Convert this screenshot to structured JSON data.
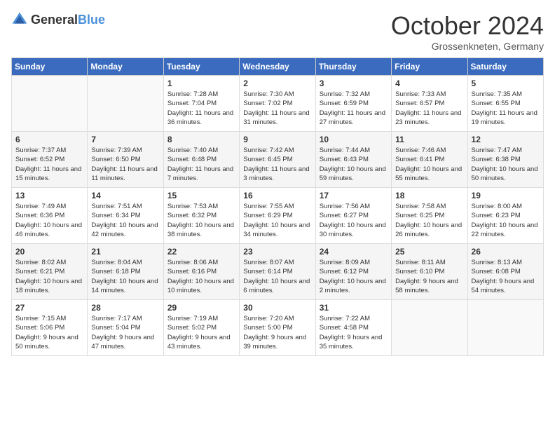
{
  "header": {
    "logo_general": "General",
    "logo_blue": "Blue",
    "month_title": "October 2024",
    "location": "Grossenkneten, Germany"
  },
  "days_of_week": [
    "Sunday",
    "Monday",
    "Tuesday",
    "Wednesday",
    "Thursday",
    "Friday",
    "Saturday"
  ],
  "weeks": [
    [
      {
        "day": "",
        "info": ""
      },
      {
        "day": "",
        "info": ""
      },
      {
        "day": "1",
        "info": "Sunrise: 7:28 AM\nSunset: 7:04 PM\nDaylight: 11 hours and 36 minutes."
      },
      {
        "day": "2",
        "info": "Sunrise: 7:30 AM\nSunset: 7:02 PM\nDaylight: 11 hours and 31 minutes."
      },
      {
        "day": "3",
        "info": "Sunrise: 7:32 AM\nSunset: 6:59 PM\nDaylight: 11 hours and 27 minutes."
      },
      {
        "day": "4",
        "info": "Sunrise: 7:33 AM\nSunset: 6:57 PM\nDaylight: 11 hours and 23 minutes."
      },
      {
        "day": "5",
        "info": "Sunrise: 7:35 AM\nSunset: 6:55 PM\nDaylight: 11 hours and 19 minutes."
      }
    ],
    [
      {
        "day": "6",
        "info": "Sunrise: 7:37 AM\nSunset: 6:52 PM\nDaylight: 11 hours and 15 minutes."
      },
      {
        "day": "7",
        "info": "Sunrise: 7:39 AM\nSunset: 6:50 PM\nDaylight: 11 hours and 11 minutes."
      },
      {
        "day": "8",
        "info": "Sunrise: 7:40 AM\nSunset: 6:48 PM\nDaylight: 11 hours and 7 minutes."
      },
      {
        "day": "9",
        "info": "Sunrise: 7:42 AM\nSunset: 6:45 PM\nDaylight: 11 hours and 3 minutes."
      },
      {
        "day": "10",
        "info": "Sunrise: 7:44 AM\nSunset: 6:43 PM\nDaylight: 10 hours and 59 minutes."
      },
      {
        "day": "11",
        "info": "Sunrise: 7:46 AM\nSunset: 6:41 PM\nDaylight: 10 hours and 55 minutes."
      },
      {
        "day": "12",
        "info": "Sunrise: 7:47 AM\nSunset: 6:38 PM\nDaylight: 10 hours and 50 minutes."
      }
    ],
    [
      {
        "day": "13",
        "info": "Sunrise: 7:49 AM\nSunset: 6:36 PM\nDaylight: 10 hours and 46 minutes."
      },
      {
        "day": "14",
        "info": "Sunrise: 7:51 AM\nSunset: 6:34 PM\nDaylight: 10 hours and 42 minutes."
      },
      {
        "day": "15",
        "info": "Sunrise: 7:53 AM\nSunset: 6:32 PM\nDaylight: 10 hours and 38 minutes."
      },
      {
        "day": "16",
        "info": "Sunrise: 7:55 AM\nSunset: 6:29 PM\nDaylight: 10 hours and 34 minutes."
      },
      {
        "day": "17",
        "info": "Sunrise: 7:56 AM\nSunset: 6:27 PM\nDaylight: 10 hours and 30 minutes."
      },
      {
        "day": "18",
        "info": "Sunrise: 7:58 AM\nSunset: 6:25 PM\nDaylight: 10 hours and 26 minutes."
      },
      {
        "day": "19",
        "info": "Sunrise: 8:00 AM\nSunset: 6:23 PM\nDaylight: 10 hours and 22 minutes."
      }
    ],
    [
      {
        "day": "20",
        "info": "Sunrise: 8:02 AM\nSunset: 6:21 PM\nDaylight: 10 hours and 18 minutes."
      },
      {
        "day": "21",
        "info": "Sunrise: 8:04 AM\nSunset: 6:18 PM\nDaylight: 10 hours and 14 minutes."
      },
      {
        "day": "22",
        "info": "Sunrise: 8:06 AM\nSunset: 6:16 PM\nDaylight: 10 hours and 10 minutes."
      },
      {
        "day": "23",
        "info": "Sunrise: 8:07 AM\nSunset: 6:14 PM\nDaylight: 10 hours and 6 minutes."
      },
      {
        "day": "24",
        "info": "Sunrise: 8:09 AM\nSunset: 6:12 PM\nDaylight: 10 hours and 2 minutes."
      },
      {
        "day": "25",
        "info": "Sunrise: 8:11 AM\nSunset: 6:10 PM\nDaylight: 9 hours and 58 minutes."
      },
      {
        "day": "26",
        "info": "Sunrise: 8:13 AM\nSunset: 6:08 PM\nDaylight: 9 hours and 54 minutes."
      }
    ],
    [
      {
        "day": "27",
        "info": "Sunrise: 7:15 AM\nSunset: 5:06 PM\nDaylight: 9 hours and 50 minutes."
      },
      {
        "day": "28",
        "info": "Sunrise: 7:17 AM\nSunset: 5:04 PM\nDaylight: 9 hours and 47 minutes."
      },
      {
        "day": "29",
        "info": "Sunrise: 7:19 AM\nSunset: 5:02 PM\nDaylight: 9 hours and 43 minutes."
      },
      {
        "day": "30",
        "info": "Sunrise: 7:20 AM\nSunset: 5:00 PM\nDaylight: 9 hours and 39 minutes."
      },
      {
        "day": "31",
        "info": "Sunrise: 7:22 AM\nSunset: 4:58 PM\nDaylight: 9 hours and 35 minutes."
      },
      {
        "day": "",
        "info": ""
      },
      {
        "day": "",
        "info": ""
      }
    ]
  ]
}
